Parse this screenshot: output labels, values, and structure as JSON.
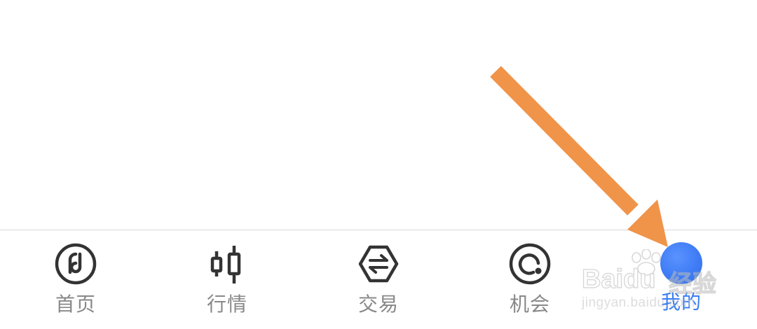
{
  "tab_bar": {
    "tabs": [
      {
        "label": "首页",
        "icon": "home-icon",
        "active": false
      },
      {
        "label": "行情",
        "icon": "candlestick-icon",
        "active": false
      },
      {
        "label": "交易",
        "icon": "trade-icon",
        "active": false
      },
      {
        "label": "机会",
        "icon": "opportunity-icon",
        "active": false
      },
      {
        "label": "我的",
        "icon": "avatar",
        "active": true
      }
    ]
  },
  "colors": {
    "icon": "#333333",
    "label": "#888888",
    "active": "#3a7ef2",
    "arrow": "#f0944a",
    "divider": "#d8d8d8"
  },
  "watermark": {
    "brand": "Baidu",
    "brand_cn": "经验",
    "url": "jingyan.baidu.com"
  }
}
